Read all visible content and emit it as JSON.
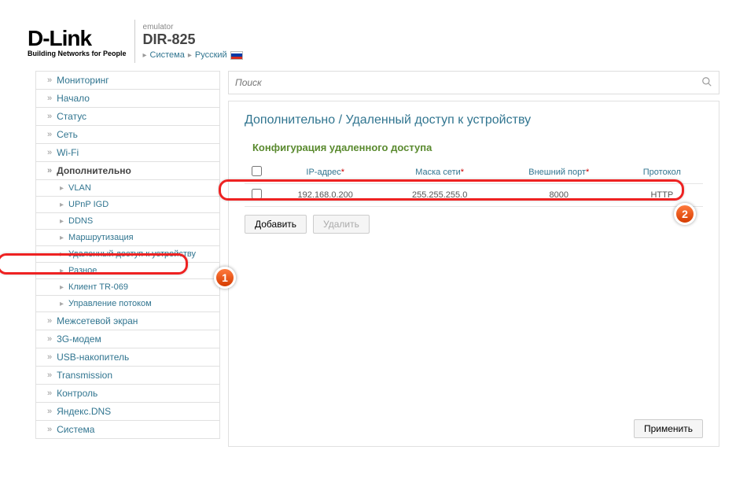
{
  "header": {
    "brand": "D-Link",
    "tagline": "Building Networks for People",
    "emulator": "emulator",
    "model": "DIR-825",
    "bc_system": "Система",
    "bc_lang": "Русский"
  },
  "search": {
    "placeholder": "Поиск"
  },
  "sidebar": {
    "items": [
      {
        "label": "Мониторинг",
        "sub": false
      },
      {
        "label": "Начало",
        "sub": false
      },
      {
        "label": "Статус",
        "sub": false
      },
      {
        "label": "Сеть",
        "sub": false
      },
      {
        "label": "Wi-Fi",
        "sub": false
      },
      {
        "label": "Дополнительно",
        "sub": false,
        "activeParent": true
      },
      {
        "label": "VLAN",
        "sub": true
      },
      {
        "label": "UPnP IGD",
        "sub": true
      },
      {
        "label": "DDNS",
        "sub": true
      },
      {
        "label": "Маршрутизация",
        "sub": true
      },
      {
        "label": "Удаленный доступ к устройству",
        "sub": true,
        "active": true
      },
      {
        "label": "Разное",
        "sub": true
      },
      {
        "label": "Клиент TR-069",
        "sub": true
      },
      {
        "label": "Управление потоком",
        "sub": true
      },
      {
        "label": "Межсетевой экран",
        "sub": false
      },
      {
        "label": "3G-модем",
        "sub": false
      },
      {
        "label": "USB-накопитель",
        "sub": false
      },
      {
        "label": "Transmission",
        "sub": false
      },
      {
        "label": "Контроль",
        "sub": false
      },
      {
        "label": "Яндекс.DNS",
        "sub": false
      },
      {
        "label": "Система",
        "sub": false
      }
    ]
  },
  "main": {
    "breadcrumb": "Дополнительно /  Удаленный доступ к устройству",
    "section": "Конфигурация удаленного доступа",
    "columns": {
      "ip": "IP-адрес",
      "mask": "Маска сети",
      "port": "Внешний порт",
      "proto": "Протокол"
    },
    "rows": [
      {
        "ip": "192.168.0.200",
        "mask": "255.255.255.0",
        "port": "8000",
        "proto": "HTTP"
      }
    ],
    "btn_add": "Добавить",
    "btn_del": "Удалить",
    "btn_apply": "Применить"
  },
  "annotations": {
    "one": "1",
    "two": "2"
  }
}
